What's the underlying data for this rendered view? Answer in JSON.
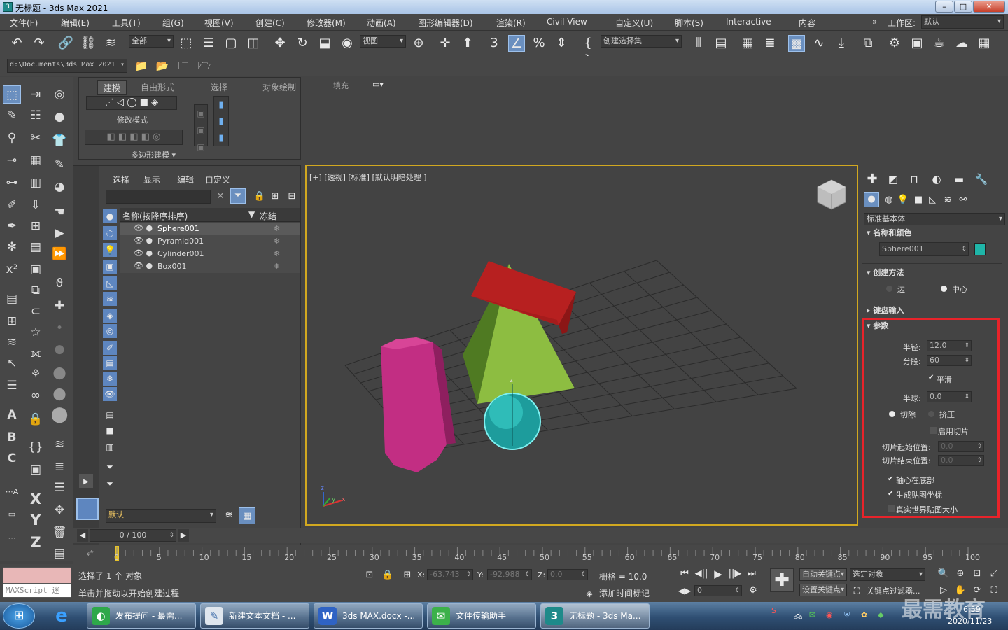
{
  "window": {
    "title": "无标题 - 3ds Max 2021",
    "min": "–",
    "max": "□",
    "close": "✕"
  },
  "menu": [
    "文件(F)",
    "编辑(E)",
    "工具(T)",
    "组(G)",
    "视图(V)",
    "创建(C)",
    "修改器(M)",
    "动画(A)",
    "图形编辑器(D)",
    "渲染(R)",
    "Civil View",
    "自定义(U)",
    "脚本(S)",
    "Interactive",
    "内容"
  ],
  "workspace": {
    "label": "工作区:",
    "value": "默认",
    "chevron": "»"
  },
  "toolbar": {
    "select_filter": "全部",
    "coord": "视图",
    "selset": "创建选择集",
    "path": "d:\\Documents\\3ds Max 2021"
  },
  "ribbon": {
    "tabs": [
      "建模",
      "自由形式",
      "选择",
      "对象绘制",
      "填充"
    ],
    "mod_mode": "修改模式",
    "poly": "多边形建模 ▾"
  },
  "explorer": {
    "tabs": [
      "选择",
      "显示",
      "编辑",
      "自定义"
    ],
    "col_name": "名称(按降序排序)",
    "col_freeze": "冻结",
    "items": [
      "Sphere001",
      "Pyramid001",
      "Cylinder001",
      "Box001"
    ],
    "layer": "默认"
  },
  "viewport": {
    "label": "[+] [透视] [标准] [默认明暗处理 ]",
    "gizmo_z": "z",
    "axis_x": "x",
    "axis_y": "y",
    "axis_z": "z"
  },
  "cmdpanel": {
    "category": "标准基本体",
    "rollout_name": "名称和颜色",
    "object_name": "Sphere001",
    "object_color": "#1fb5a8",
    "creation": "创建方法",
    "edge": "边",
    "center": "中心",
    "keyboard": "键盘输入",
    "params": "参数",
    "radius_l": "半径:",
    "radius": "12.0",
    "segs_l": "分段:",
    "segs": "60",
    "smooth": "平滑",
    "hemi_l": "半球:",
    "hemi": "0.0",
    "chop": "切除",
    "squash": "挤压",
    "slice_on": "启用切片",
    "slice_from": "切片起始位置:",
    "slice_from_v": "0.0",
    "slice_to": "切片结束位置:",
    "slice_to_v": "0.0",
    "base_pivot": "轴心在底部",
    "gen_map": "生成贴图坐标",
    "real_world": "真实世界贴图大小",
    "highlight_color": "#e8232a"
  },
  "timeline": {
    "frame": "0 / 100",
    "ticks": [
      "0",
      "5",
      "10",
      "15",
      "20",
      "25",
      "30",
      "35",
      "40",
      "45",
      "50",
      "55",
      "60",
      "65",
      "70",
      "75",
      "80",
      "85",
      "90",
      "95",
      "100"
    ]
  },
  "status": {
    "maxscript": "MAXScript 迷",
    "sel": "选择了 1 个 对象",
    "hint": "单击并拖动以开始创建过程",
    "x_l": "X:",
    "x": "-63.743",
    "y_l": "Y:",
    "y": "-92.988",
    "z_l": "Z:",
    "z": "0.0",
    "grid": "栅格 = 10.0",
    "addtime": "添加时间标记",
    "autokey": "自动关键点",
    "setkey": "设置关键点",
    "selobj": "选定对象",
    "keyfilter": "关键点过滤器...",
    "frame_field": "0"
  },
  "taskbar": {
    "items": [
      "发布提问 - 最需...",
      "新建文本文档 - ...",
      "3ds MAX.docx -...",
      "文件传输助手",
      "无标题 - 3ds Ma..."
    ],
    "time": "6:59",
    "date": "2020/11/23",
    "watermark": "最需教育"
  }
}
